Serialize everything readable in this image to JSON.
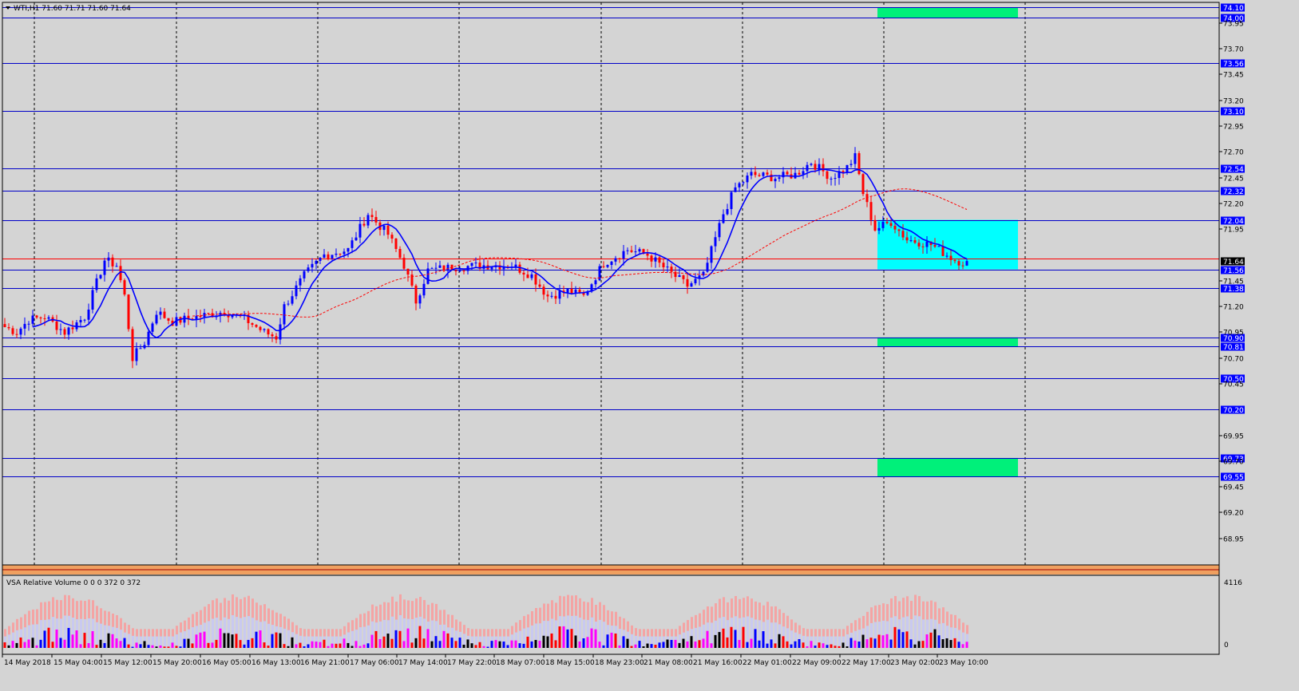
{
  "window": {
    "symbol_line": "WTI,H1  71.60 71.71 71.60 71.64"
  },
  "volume_panel": {
    "title": "VSA Relative Volume 0 0 0 372 0 372",
    "scale_top": "4116",
    "scale_bottom": "0"
  },
  "colors": {
    "background": "#d4d4d4",
    "bull": "#0000ff",
    "bear": "#ff0000",
    "level_line": "#0000c8",
    "zone_cyan": "#00ffff",
    "zone_green": "#00f07a",
    "ma_fast": "#0000ff",
    "ma_slow": "#ff0000",
    "price_label_bg": "#0000ff"
  },
  "chart_data": {
    "type": "candlestick",
    "title": "WTI,H1",
    "ylim": [
      68.7,
      74.15
    ],
    "y_ticks": [
      "73.95",
      "73.70",
      "73.45",
      "73.20",
      "72.95",
      "72.70",
      "72.45",
      "72.20",
      "71.95",
      "71.45",
      "71.20",
      "70.95",
      "70.70",
      "70.45",
      "69.95",
      "69.70",
      "69.45",
      "69.20",
      "68.95"
    ],
    "x_labels": [
      "14 May 2018",
      "15 May 04:00",
      "15 May 12:00",
      "15 May 20:00",
      "16 May 05:00",
      "16 May 13:00",
      "16 May 21:00",
      "17 May 06:00",
      "17 May 14:00",
      "17 May 22:00",
      "18 May 07:00",
      "18 May 15:00",
      "18 May 23:00",
      "21 May 08:00",
      "21 May 16:00",
      "22 May 01:00",
      "22 May 09:00",
      "22 May 17:00",
      "23 May 02:00",
      "23 May 10:00"
    ],
    "levels": [
      "74.10",
      "74.00",
      "73.56",
      "73.10",
      "72.54",
      "72.32",
      "72.04",
      "71.56",
      "71.38",
      "70.90",
      "70.81",
      "70.50",
      "70.20",
      "69.73",
      "69.55"
    ],
    "current_price": "71.64",
    "zones": [
      {
        "kind": "green",
        "y": [
          74.0,
          74.1
        ]
      },
      {
        "kind": "cyan",
        "y": [
          71.56,
          72.04
        ]
      },
      {
        "kind": "green",
        "y": [
          70.81,
          70.9
        ]
      },
      {
        "kind": "green",
        "y": [
          69.55,
          69.73
        ]
      }
    ],
    "anchors": [
      [
        0,
        71.0
      ],
      [
        3,
        70.95
      ],
      [
        6,
        71.07
      ],
      [
        10,
        71.1
      ],
      [
        15,
        70.95
      ],
      [
        20,
        71.1
      ],
      [
        25,
        71.65
      ],
      [
        28,
        71.6
      ],
      [
        30,
        71.3
      ],
      [
        32,
        70.7
      ],
      [
        35,
        70.85
      ],
      [
        38,
        71.15
      ],
      [
        42,
        71.05
      ],
      [
        48,
        71.1
      ],
      [
        55,
        71.15
      ],
      [
        60,
        71.08
      ],
      [
        65,
        70.95
      ],
      [
        68,
        70.9
      ],
      [
        70,
        71.2
      ],
      [
        75,
        71.5
      ],
      [
        80,
        71.7
      ],
      [
        86,
        71.75
      ],
      [
        91,
        72.1
      ],
      [
        96,
        71.9
      ],
      [
        100,
        71.6
      ],
      [
        103,
        71.25
      ],
      [
        106,
        71.55
      ],
      [
        112,
        71.58
      ],
      [
        120,
        71.6
      ],
      [
        127,
        71.6
      ],
      [
        132,
        71.5
      ],
      [
        136,
        71.3
      ],
      [
        141,
        71.35
      ],
      [
        145,
        71.3
      ],
      [
        150,
        71.62
      ],
      [
        156,
        71.75
      ],
      [
        161,
        71.7
      ],
      [
        166,
        71.55
      ],
      [
        171,
        71.4
      ],
      [
        175,
        71.5
      ],
      [
        180,
        72.1
      ],
      [
        183,
        72.35
      ],
      [
        187,
        72.48
      ],
      [
        193,
        72.45
      ],
      [
        198,
        72.48
      ],
      [
        202,
        72.6
      ],
      [
        207,
        72.45
      ],
      [
        211,
        72.55
      ],
      [
        213,
        72.65
      ],
      [
        215,
        72.3
      ],
      [
        218,
        71.95
      ],
      [
        222,
        72.02
      ],
      [
        226,
        71.85
      ],
      [
        232,
        71.8
      ],
      [
        238,
        71.65
      ],
      [
        241,
        71.62
      ]
    ],
    "moving_averages": [
      {
        "style": "solid",
        "period": 8
      },
      {
        "style": "dashed",
        "period": 48
      }
    ]
  }
}
